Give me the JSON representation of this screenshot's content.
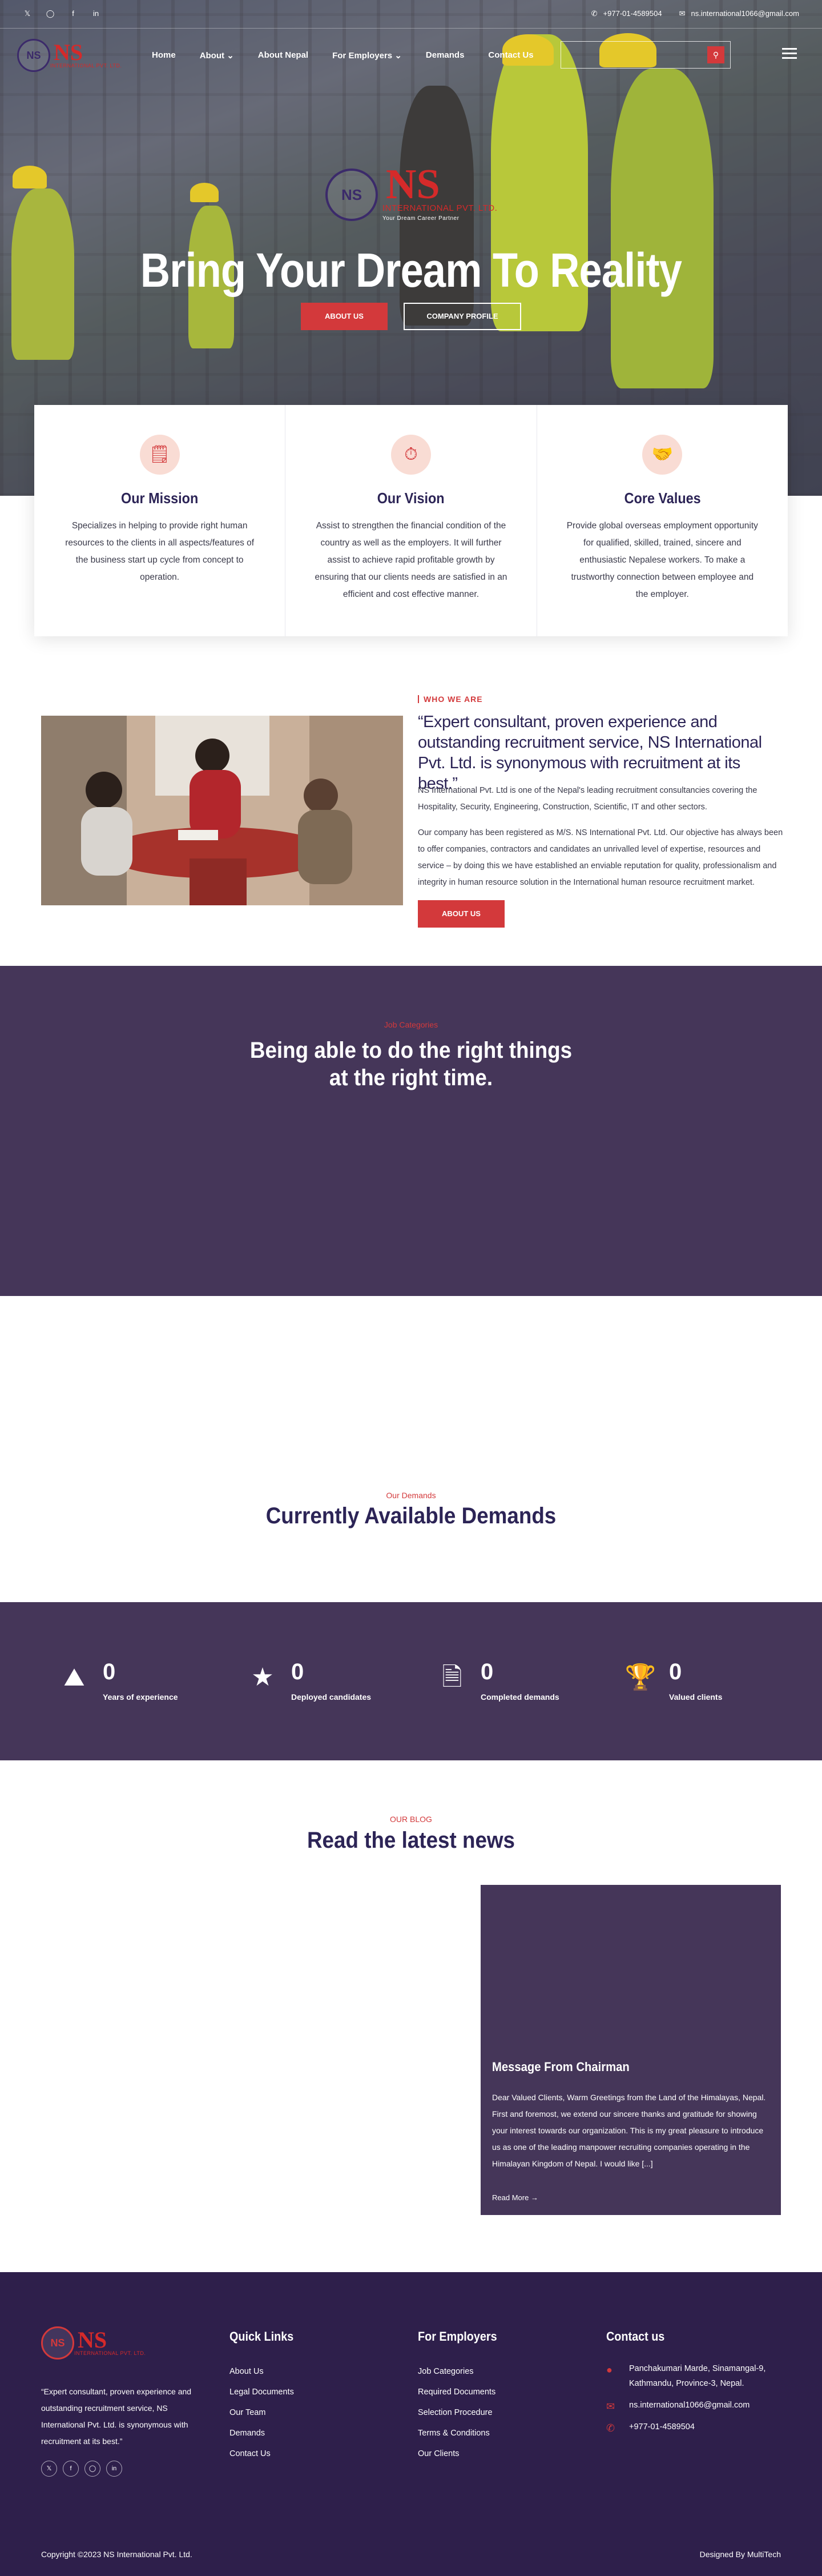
{
  "topbar": {
    "social": [
      "twitter-icon",
      "instagram-icon",
      "facebook-icon",
      "linkedin-icon"
    ],
    "phone": "+977-01-4589504",
    "email": "ns.international1066@gmail.com"
  },
  "brand": {
    "name": "NS",
    "sub": "INTERNATIONAL PVT. LTD.",
    "tagline": "Your Dream Career Partner"
  },
  "nav": {
    "items": [
      "Home",
      "About",
      "About Nepal",
      "For Employers",
      "Demands",
      "Contact Us"
    ]
  },
  "hero": {
    "title": "Bring Your Dream To Reality",
    "btn_about": "ABOUT US",
    "btn_profile": "COMPANY PROFILE"
  },
  "cards": [
    {
      "title": "Our Mission",
      "text": "Specializes in helping to provide right human resources to the clients in all aspects/features of the business start up cycle from concept to operation."
    },
    {
      "title": "Our Vision",
      "text": "Assist to strengthen the financial condition of the country as well as the employers.  It will further assist to achieve rapid profitable growth by ensuring that our clients needs are satisfied in an efficient and cost effective manner."
    },
    {
      "title": "Core Values",
      "text": "Provide global overseas employment opportunity for qualified, skilled, trained, sincere and enthusiastic Nepalese workers.  To make a trustworthy connection between employee and the employer."
    }
  ],
  "who": {
    "tag": "WHO WE ARE",
    "quote": "“Expert consultant, proven experience and outstanding recruitment service, NS International Pvt. Ltd. is synonymous with recruitment at its best.”",
    "p1": "NS International Pvt. Ltd is one of the Nepal's leading recruitment consultancies covering the Hospitality, Security, Engineering, Construction, Scientific, IT and other sectors.",
    "p2": "Our company has been registered as M/S. NS International Pvt. Ltd. Our objective has always been to offer companies, contractors and candidates an unrivalled level of expertise, resources and service – by doing this we have established an enviable reputation for quality, professionalism and integrity in human resource solution in the International human resource recruitment market.",
    "btn": "ABOUT US"
  },
  "categories": {
    "eyebrow": "Job Categories",
    "title_line1": "Being able to do the right things",
    "title_line2": "at the right time."
  },
  "demands": {
    "eyebrow": "Our Demands",
    "title": "Currently Available Demands"
  },
  "stats": [
    {
      "icon": "experience-icon",
      "value": "0",
      "label": "Years of experience"
    },
    {
      "icon": "candidates-icon",
      "value": "0",
      "label": "Deployed candidates"
    },
    {
      "icon": "document-icon",
      "value": "0",
      "label": "Completed demands"
    },
    {
      "icon": "trophy-icon",
      "value": "0",
      "label": "Valued clients"
    }
  ],
  "blog": {
    "eyebrow": "OUR BLOG",
    "title": "Read the latest news",
    "card_title": "Message From Chairman",
    "card_text": "Dear Valued Clients, Warm Greetings from the Land of the Himalayas, Nepal.  First and foremost, we extend our sincere thanks and gratitude for showing your interest towards our organization.  This is my great pleasure to introduce us as one of the leading manpower recruiting companies operating in the Himalayan Kingdom of Nepal.  I would like [...]",
    "read_more": "Read More"
  },
  "footer": {
    "about": "“Expert consultant, proven experience and outstanding recruitment service, NS International Pvt. Ltd. is synonymous with recruitment at its best.”",
    "quick_title": "Quick Links",
    "quick": [
      "About Us",
      "Legal Documents",
      "Our Team",
      "Demands",
      "Contact Us"
    ],
    "emp_title": "For Employers",
    "emp": [
      "Job Categories",
      "Required Documents",
      "Selection Procedure",
      "Terms & Conditions",
      "Our Clients"
    ],
    "contact_title": "Contact us",
    "address": "Panchakumari Marde, Sinamangal-9, Kathmandu, Province-3, Nepal.",
    "email": "ns.international1066@gmail.com",
    "phone": "+977-01-4589504",
    "copyright": "Copyright ©2023 NS International Pvt. Ltd.",
    "designed": "Designed By MultiTech"
  },
  "colors": {
    "accent": "#d3393b",
    "purple": "#453659",
    "navy": "#2c2456",
    "footer": "#2e1f4b"
  }
}
